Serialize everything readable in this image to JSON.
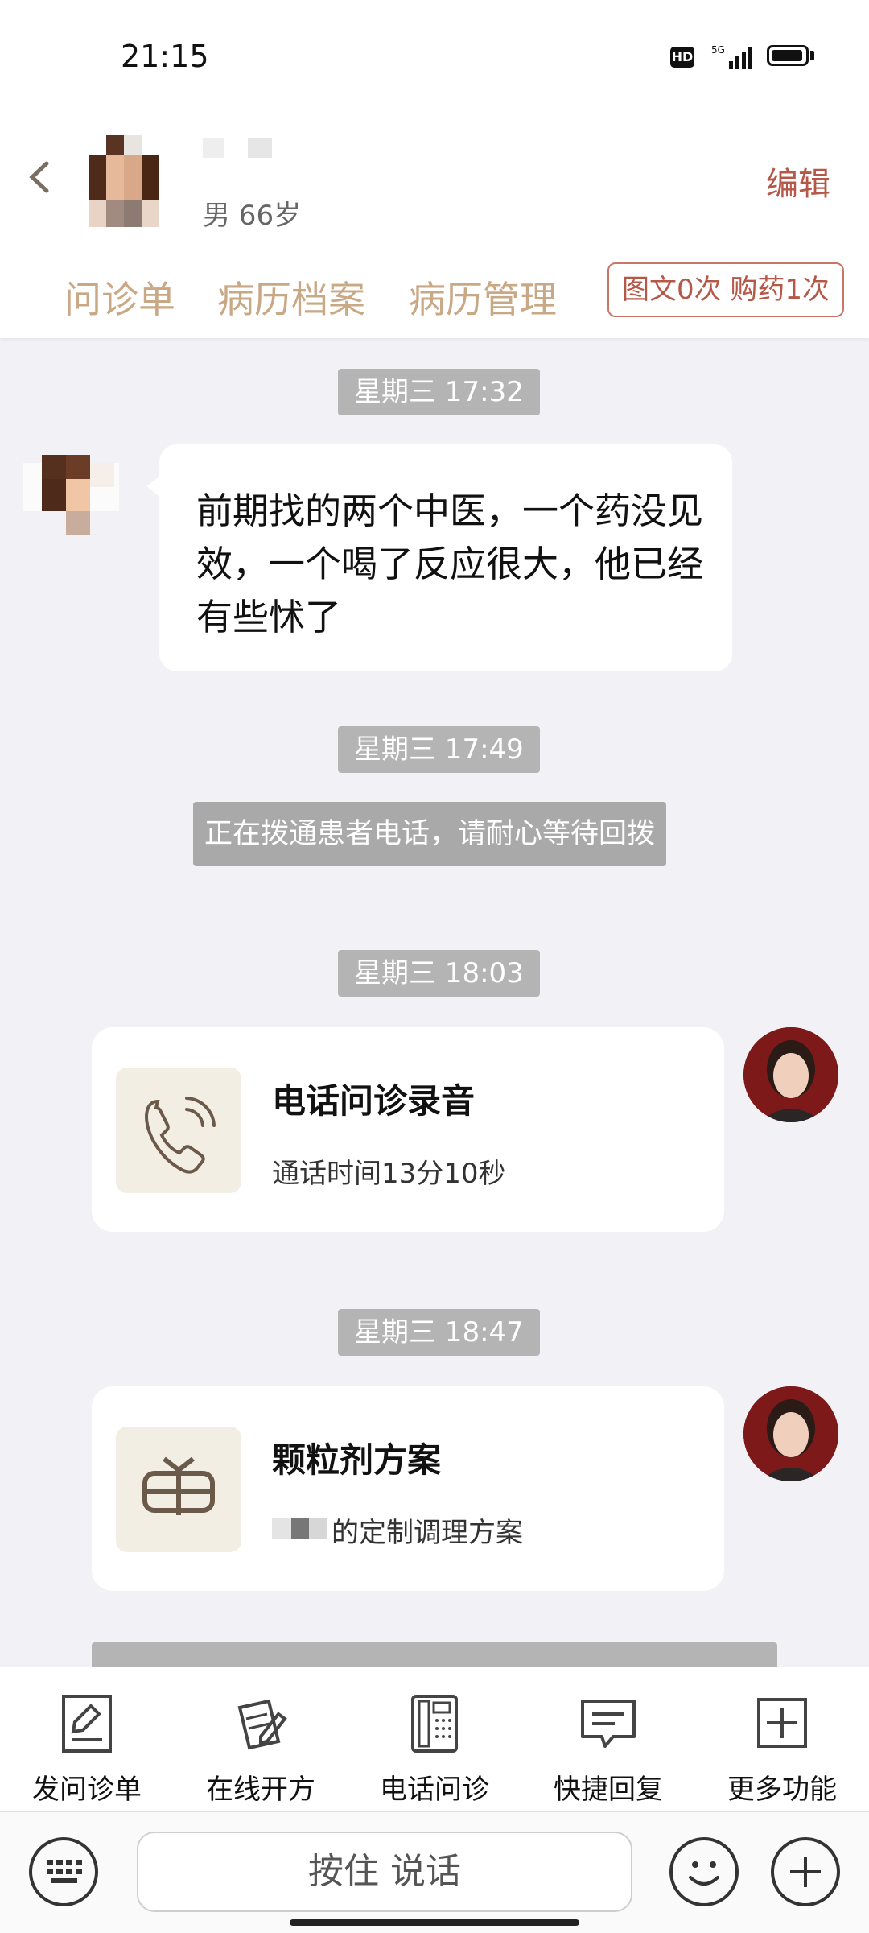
{
  "status_bar": {
    "time": "21:15",
    "network": "5G",
    "hd": "HD"
  },
  "header": {
    "age_label": "男 66岁",
    "edit_label": "编辑",
    "tabs": [
      "问诊单",
      "病历档案",
      "病历管理"
    ],
    "badge": "图文0次 购药1次"
  },
  "chat": {
    "ts1": "星期三 17:32",
    "patient_message": "前期找的两个中医，一个药没见效，一个喝了反应很大，他已经有些怵了",
    "ts2": "星期三 17:49",
    "system_notice": "正在拨通患者电话，请耐心等待回拨",
    "ts3": "星期三 18:03",
    "call_card": {
      "title": "电话问诊录音",
      "subtitle": "通话时间13分10秒",
      "icon": "phone-icon"
    },
    "ts4": "星期三 18:47",
    "rx_card": {
      "title": "颗粒剂方案",
      "subtitle": "的定制调理方案",
      "icon": "granule-icon"
    }
  },
  "toolbar": [
    {
      "label": "发问诊单",
      "icon": "form-icon"
    },
    {
      "label": "在线开方",
      "icon": "prescription-icon"
    },
    {
      "label": "电话问诊",
      "icon": "telephone-icon"
    },
    {
      "label": "快捷回复",
      "icon": "quick-reply-icon"
    },
    {
      "label": "更多功能",
      "icon": "more-icon"
    }
  ],
  "input_bar": {
    "hold_to_talk": "按住 说话"
  },
  "colors": {
    "accent": "#b65848",
    "tab_text": "#c9a985",
    "timestamp_bg": "#b4b4b4",
    "chat_bg": "#f1f1f6"
  }
}
